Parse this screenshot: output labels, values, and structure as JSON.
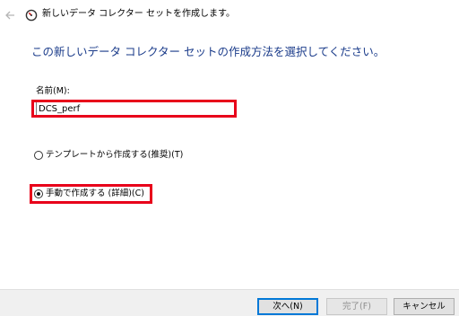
{
  "window": {
    "title": "新しいデータ コレクター セットを作成します。"
  },
  "main": {
    "heading": "この新しいデータ コレクター セットの作成方法を選択してください。",
    "name_label": "名前(M):",
    "name_value": "DCS_perf",
    "options": [
      {
        "label": "テンプレートから作成する(推奨)(T)",
        "checked": false
      },
      {
        "label": "手動で作成する (詳細)(C)",
        "checked": true
      }
    ]
  },
  "buttons": {
    "next": "次へ(N)",
    "finish": "完了(F)",
    "cancel": "キャンセル",
    "finish_enabled": false
  },
  "colors": {
    "heading": "#1a3b8a",
    "highlight": "#e8001a",
    "footer_background": "#f0f0f0",
    "default_button_border": "#0078d7"
  },
  "icons": {
    "back": "back-arrow-icon",
    "app": "performance-monitor-icon"
  }
}
